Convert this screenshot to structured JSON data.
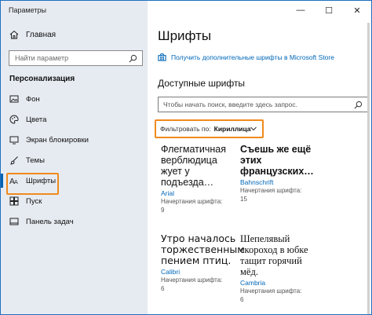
{
  "window": {
    "title": "Параметры",
    "controls": {
      "minimize": "—",
      "maximize": "☐",
      "close": "✕"
    }
  },
  "sidebar": {
    "home_label": "Главная",
    "search_placeholder": "Найти параметр",
    "section_title": "Персонализация",
    "items": [
      {
        "label": "Фон",
        "icon": "image-icon"
      },
      {
        "label": "Цвета",
        "icon": "palette-icon"
      },
      {
        "label": "Экран блокировки",
        "icon": "lock-screen-icon"
      },
      {
        "label": "Темы",
        "icon": "brush-icon"
      },
      {
        "label": "Шрифты",
        "icon": "font-icon",
        "active": true
      },
      {
        "label": "Пуск",
        "icon": "start-icon"
      },
      {
        "label": "Панель задач",
        "icon": "taskbar-icon"
      }
    ]
  },
  "main": {
    "title": "Шрифты",
    "store_link": "Получить дополнительные шрифты в Microsoft Store",
    "available_title": "Доступные шрифты",
    "search_placeholder": "Чтобы начать поиск, введите здесь запрос.",
    "filter": {
      "label": "Фильтровать по:",
      "value": "Кириллица"
    },
    "fonts": [
      {
        "sample": "Флегматичная верблюдица жует у подъезда…",
        "name": "Arial",
        "meta1": "Начертания шрифта:",
        "meta2": "9"
      },
      {
        "sample": "Съешь же ещё этих французских…",
        "name": "Bahnschrift",
        "meta1": "Начертания шрифта:",
        "meta2": "15"
      },
      {
        "sample": "Утро началось торжественным пением птиц.",
        "name": "Calibri",
        "meta1": "Начертания шрифта:",
        "meta2": "6"
      },
      {
        "sample": "Шепелявый скороход в юбке тащит горячий мёд.",
        "name": "Cambria",
        "meta1": "Начертания шрифта:",
        "meta2": "6"
      }
    ]
  },
  "colors": {
    "accent": "#0063b1",
    "link": "#0067b8",
    "highlight": "#f08a1c",
    "sidebar_bg": "#e6ebf1"
  }
}
